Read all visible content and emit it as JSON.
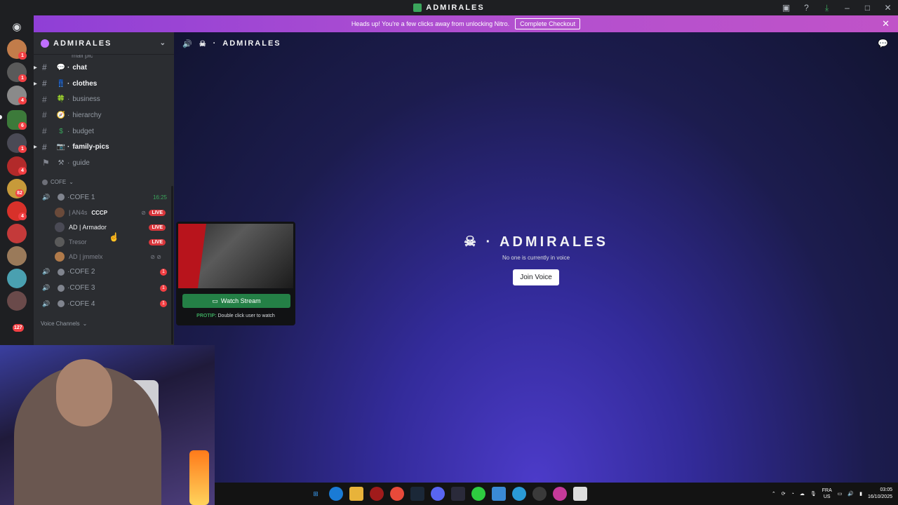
{
  "window": {
    "title": "ADMIRALES"
  },
  "nitro_banner": {
    "text": "Heads up! You're a few clicks away from unlocking Nitro.",
    "cta": "Complete Checkout"
  },
  "server_rail": {
    "badges": [
      "1",
      "1",
      "4",
      "6",
      "1",
      "4",
      "82",
      "4",
      "127"
    ]
  },
  "sidebar": {
    "server_name": "ADMIRALES",
    "cut_text": "mail pic",
    "channels": [
      {
        "name": "chat",
        "emoji": "💬",
        "bright": true,
        "unread": true
      },
      {
        "name": "clothes",
        "emoji": "👖",
        "bright": true,
        "unread": true
      },
      {
        "name": "business",
        "emoji": "🍀",
        "bright": false,
        "unread": false
      },
      {
        "name": "hierarchy",
        "emoji": "🧭",
        "bright": false,
        "unread": false
      },
      {
        "name": "budget",
        "emoji": "$",
        "bright": false,
        "unread": false
      },
      {
        "name": "family-pics",
        "emoji": "📷",
        "bright": true,
        "unread": true
      },
      {
        "name": "guide",
        "emoji": "⚒",
        "bright": false,
        "unread": false
      }
    ],
    "category_cofe": "COFE",
    "voice": [
      {
        "name": "COFE 1",
        "timer": "16:25",
        "active": true
      },
      {
        "name": "COFE 2",
        "count": "1"
      },
      {
        "name": "COFE 3",
        "count": "1"
      },
      {
        "name": "COFE 4",
        "count": "1"
      }
    ],
    "voice_users": [
      {
        "name": "| AN4s",
        "tag": "CCCP",
        "live": "LIVE"
      },
      {
        "name": "AD | Armador",
        "live": "LIVE"
      },
      {
        "name": "Tresor",
        "live": "LIVE"
      },
      {
        "name": "AD | jmmelx"
      }
    ],
    "voice_category": "Voice Channels"
  },
  "main": {
    "header_title": "ADMIRALES",
    "big_title": "ADMIRALES",
    "subtitle": "No one is currently in voice",
    "join_button": "Join Voice"
  },
  "stream_popup": {
    "watch_button": "Watch Stream",
    "protip_label": "PROTIP:",
    "protip_text": "Double click user to watch"
  },
  "taskbar": {
    "lang_top": "FRA",
    "lang_bottom": "US",
    "time": "03:05",
    "date": "16/10/2025"
  }
}
